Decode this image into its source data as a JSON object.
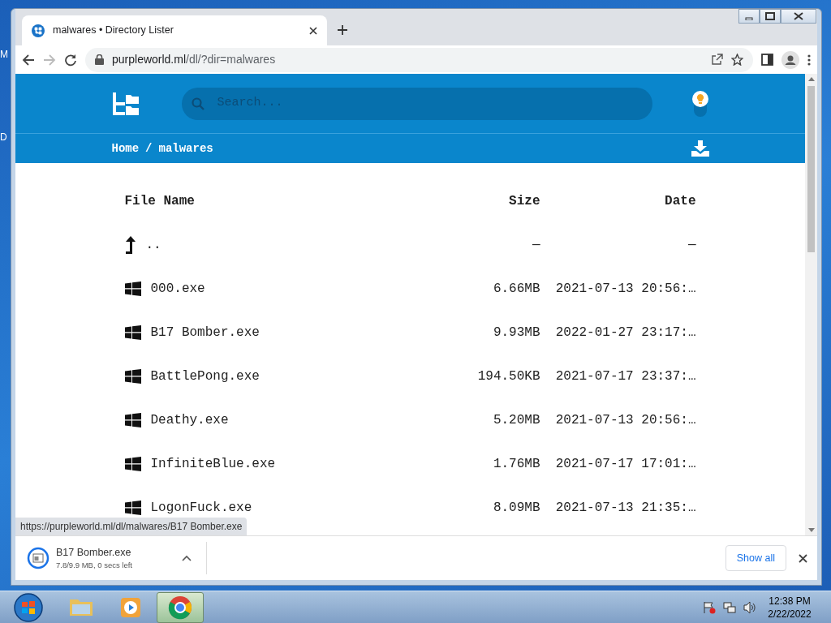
{
  "desktop": {
    "icon_labels": [
      "M",
      "D"
    ]
  },
  "browser": {
    "tabs": [
      {
        "title": "malwares • Directory Lister",
        "selected": true
      }
    ],
    "address": {
      "host": "purpleworld.ml",
      "path": "/dl/?dir=malwares"
    }
  },
  "site": {
    "search": {
      "placeholder": "Search..."
    },
    "breadcrumb": [
      "Home",
      "malwares"
    ],
    "breadcrumb_separator": "/"
  },
  "table": {
    "columns": [
      "File Name",
      "Size",
      "Date"
    ],
    "rows": [
      {
        "kind": "parent",
        "name": "..",
        "size": "—",
        "date": "—"
      },
      {
        "kind": "file",
        "name": "000.exe",
        "size": "6.66MB",
        "date": "2021-07-13 20:56:…"
      },
      {
        "kind": "file",
        "name": "B17 Bomber.exe",
        "size": "9.93MB",
        "date": "2022-01-27 23:17:…"
      },
      {
        "kind": "file",
        "name": "BattlePong.exe",
        "size": "194.50KB",
        "date": "2021-07-17 23:37:…"
      },
      {
        "kind": "file",
        "name": "Deathy.exe",
        "size": "5.20MB",
        "date": "2021-07-13 20:56:…"
      },
      {
        "kind": "file",
        "name": "InfiniteBlue.exe",
        "size": "1.76MB",
        "date": "2021-07-17 17:01:…"
      },
      {
        "kind": "file",
        "name": "LogonFuck.exe",
        "size": "8.09MB",
        "date": "2021-07-13 21:35:…"
      }
    ]
  },
  "status_url": "https://purpleworld.ml/dl/malwares/B17 Bomber.exe",
  "download": {
    "filename": "B17 Bomber.exe",
    "progress": "7.8/9.9 MB, 0 secs left",
    "show_all": "Show all"
  },
  "taskbar": {
    "apps": [
      {
        "kind": "explorer",
        "selected": false
      },
      {
        "kind": "media",
        "selected": false
      },
      {
        "kind": "chrome",
        "selected": true
      }
    ],
    "time": "12:38 PM",
    "date": "2/22/2022"
  }
}
